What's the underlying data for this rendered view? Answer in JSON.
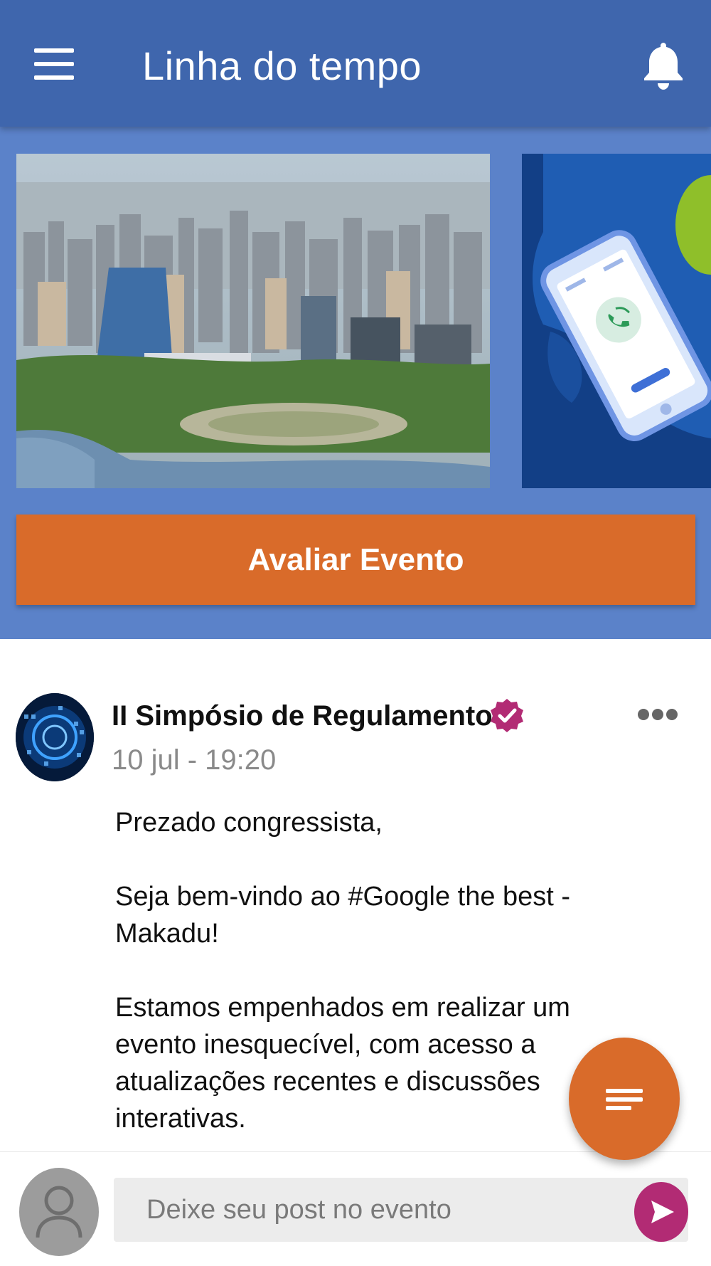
{
  "app": {
    "title": "Linha do tempo",
    "accent_color": "#3f66ad",
    "banner_color": "#5b82c9",
    "action_color": "#d96b2a",
    "verified_color": "#b22b74"
  },
  "header": {
    "menu_icon": "menu-icon",
    "notification_icon": "bell-icon"
  },
  "banner": {
    "slides": [
      {
        "image": "city-aerial-photo"
      },
      {
        "image": "phone-call-illustration"
      }
    ],
    "cta_label": "Avaliar Evento"
  },
  "post": {
    "author": "II Simpósio de Regulamento",
    "verified": true,
    "timestamp": "10 jul - 19:20",
    "body": [
      "Prezado congressista,",
      "Seja bem-vindo ao #Google the best - Makadu!",
      "Estamos empenhados em realizar um evento inesquecível, com acesso a atualizações recentes e discussões interativas."
    ]
  },
  "fab": {
    "icon": "filter-lines-icon"
  },
  "compose": {
    "placeholder": "Deixe seu post no evento",
    "send_icon": "send-icon"
  }
}
